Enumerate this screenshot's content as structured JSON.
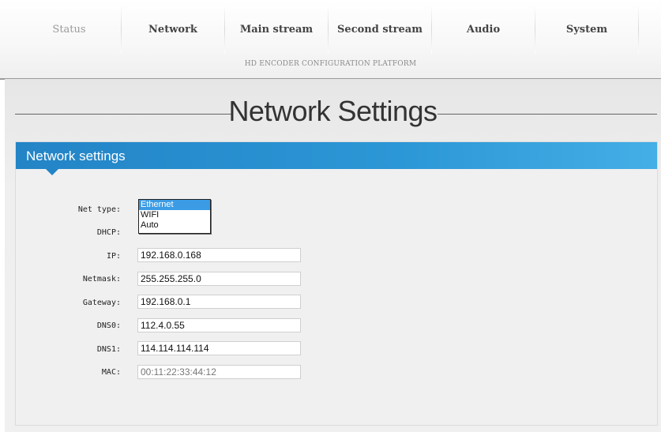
{
  "nav": {
    "items": [
      "Status",
      "Network",
      "Main stream",
      "Second stream",
      "Audio",
      "System"
    ],
    "subtitle": "HD ENCODER CONFIGURATION PLATFORM"
  },
  "page": {
    "heading": "Network Settings"
  },
  "panel": {
    "title": "Network settings",
    "fields": {
      "net_type_label": "Net type:",
      "dhcp_label": "DHCP:",
      "ip_label": "IP:",
      "ip_value": "192.168.0.168",
      "netmask_label": "Netmask:",
      "netmask_value": "255.255.255.0",
      "gateway_label": "Gateway:",
      "gateway_value": "192.168.0.1",
      "dns0_label": "DNS0:",
      "dns0_value": "112.4.0.55",
      "dns1_label": "DNS1:",
      "dns1_value": "114.114.114.114",
      "mac_label": "MAC:",
      "mac_value": "00:11:22:33:44:12"
    },
    "net_type_options": [
      "Ethernet",
      "WIFI",
      "Auto"
    ],
    "net_type_selected": "Ethernet"
  },
  "colors": {
    "accent": "#2c97d6",
    "selected_option": "#3b9be5"
  }
}
